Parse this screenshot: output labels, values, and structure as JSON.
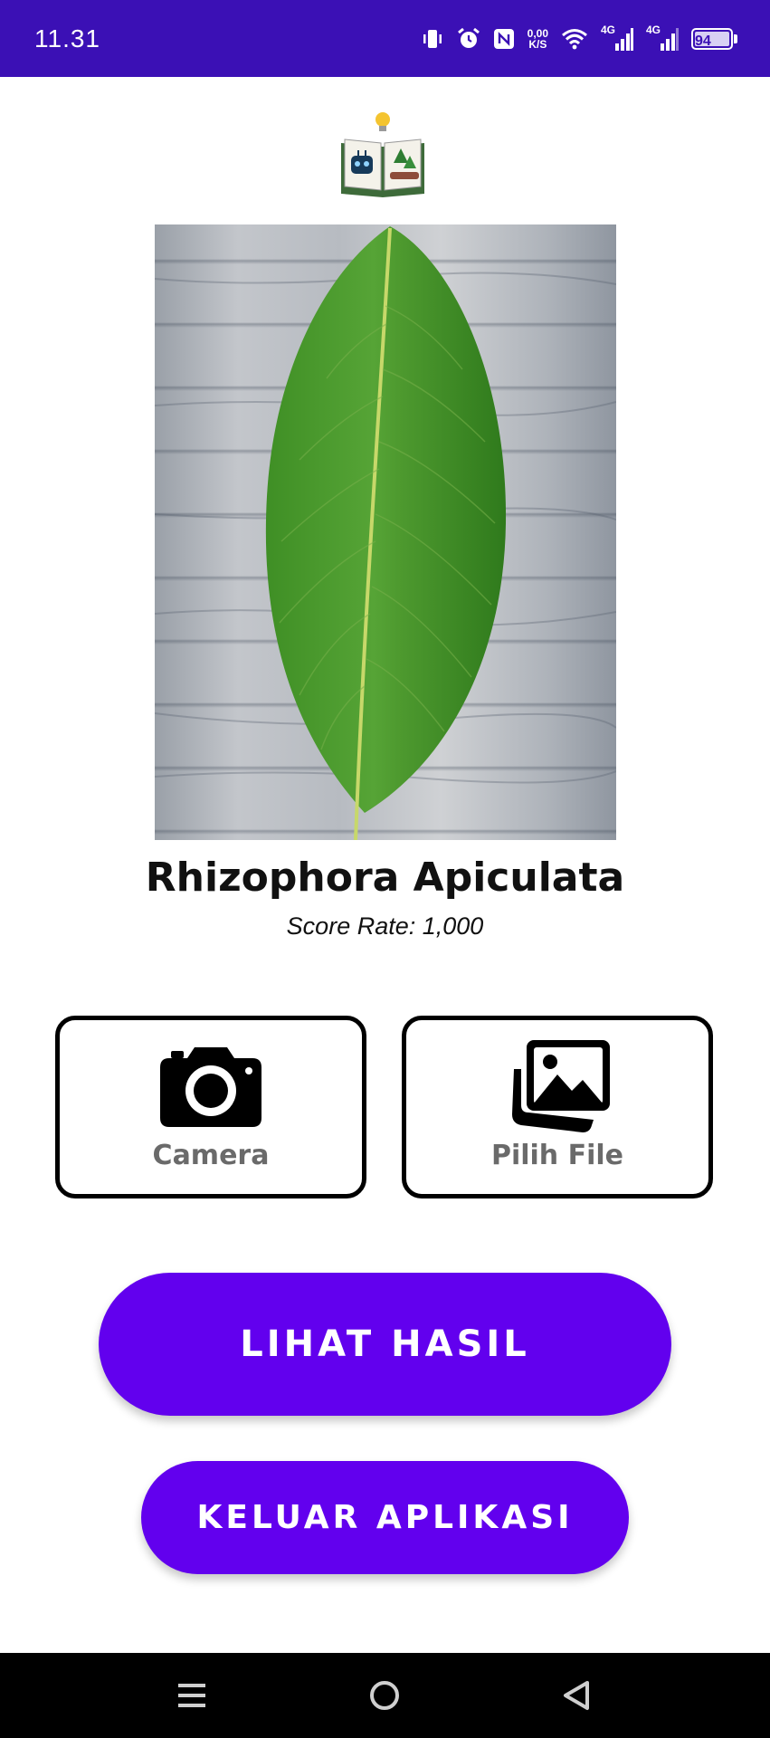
{
  "status_bar": {
    "time": "11.31",
    "net_speed_value": "0,00",
    "net_speed_unit": "K/S",
    "signal1_label": "4G",
    "signal2_label": "4G",
    "battery_level": "94",
    "icons": [
      "vibrate-icon",
      "alarm-icon",
      "nfc-icon",
      "wifi-icon",
      "signal-icon",
      "battery-icon"
    ]
  },
  "app": {
    "logo_icon": "book-robot-lightbulb-logo",
    "photo_alt": "leaf photo",
    "plant_name": "Rhizophora Apiculata",
    "score_text": "Score Rate: 1,000"
  },
  "actions": {
    "camera_label": "Camera",
    "file_label": "Pilih File"
  },
  "buttons": {
    "result_label": "LIHAT HASIL",
    "exit_label": "KELUAR APLIKASI"
  },
  "colors": {
    "status_bar": "#3b10b5",
    "primary": "#6200ee"
  },
  "nav": {
    "icons": [
      "menu-icon",
      "home-icon",
      "back-icon"
    ]
  }
}
